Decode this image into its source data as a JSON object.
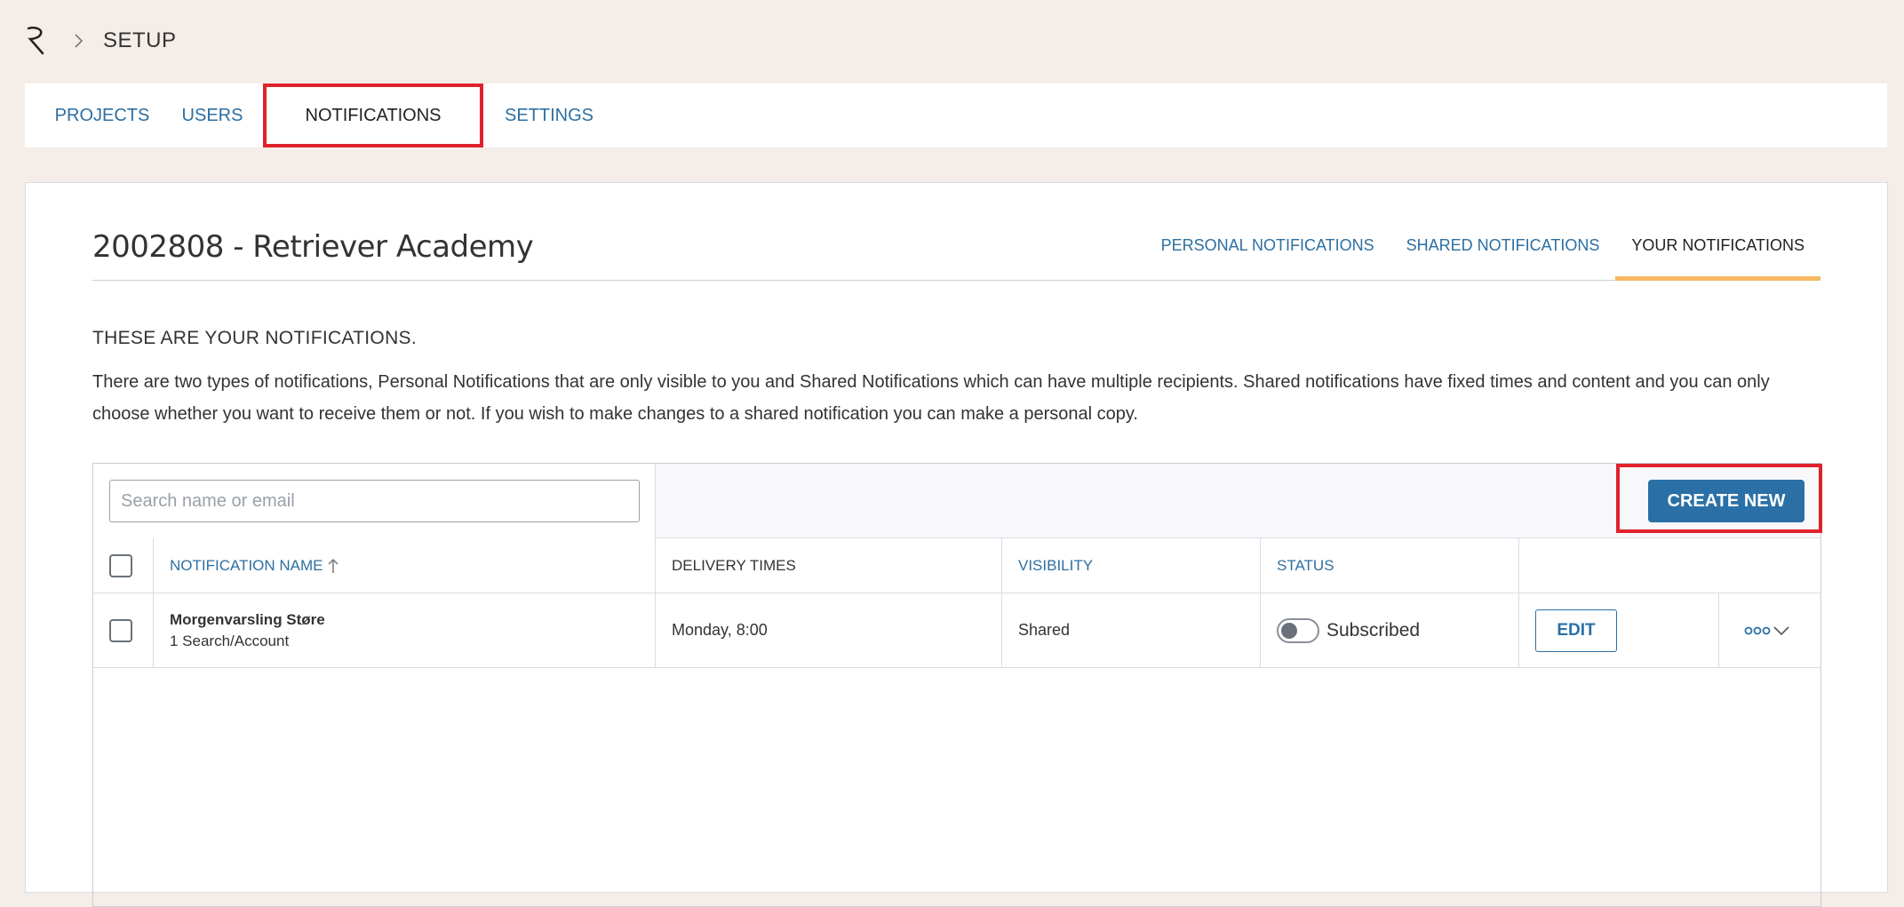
{
  "breadcrumb": {
    "logo_icon": "retriever-logo-icon",
    "separator_icon": "chevron-right-icon",
    "section": "SETUP"
  },
  "nav_tabs": [
    {
      "label": "PROJECTS",
      "active": false
    },
    {
      "label": "USERS",
      "active": false
    },
    {
      "label": "NOTIFICATIONS",
      "active": true
    },
    {
      "label": "SETTINGS",
      "active": false
    }
  ],
  "page": {
    "title": "2002808 - Retriever Academy",
    "sub_tabs": [
      {
        "label": "PERSONAL NOTIFICATIONS",
        "active": false
      },
      {
        "label": "SHARED NOTIFICATIONS",
        "active": false
      },
      {
        "label": "YOUR NOTIFICATIONS",
        "active": true
      }
    ],
    "heading": "THESE ARE YOUR NOTIFICATIONS.",
    "description": "There are two types of notifications, Personal Notifications that are only visible to you and Shared Notifications which can have multiple recipients. Shared notifications have fixed times and content and you can only choose whether you want to receive them or not. If you wish to make changes to a shared notification you can make a personal copy."
  },
  "toolbar": {
    "search_placeholder": "Search name or email",
    "search_value": "",
    "create_label": "CREATE NEW"
  },
  "table": {
    "columns": {
      "name": "NOTIFICATION NAME",
      "sort_icon": "arrow-up-icon",
      "delivery": "DELIVERY TIMES",
      "visibility": "VISIBILITY",
      "status": "STATUS"
    },
    "rows": [
      {
        "name": "Morgenvarsling Støre",
        "subtitle": "1 Search/Account",
        "delivery": "Monday, 8:00",
        "visibility": "Shared",
        "status": "Subscribed",
        "subscribed": false,
        "edit_label": "EDIT",
        "more_icon": "more-dots-chevron-icon"
      }
    ]
  },
  "colors": {
    "accent": "#2a70a6",
    "link": "#2d6fa1",
    "highlight": "#e0212b",
    "tab_underline": "#f5b863",
    "background": "#f5ede8"
  }
}
